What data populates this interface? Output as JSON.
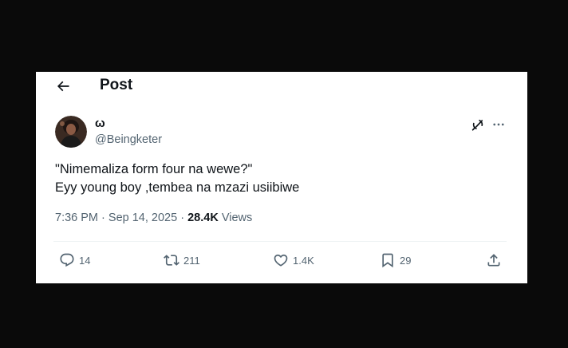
{
  "header": {
    "title": "Post",
    "back_icon": "arrow-left-icon"
  },
  "author": {
    "name": "ω",
    "handle": "@Beingketer"
  },
  "post": {
    "lines": [
      "\"Nimemaliza form four na wewe?\"",
      "Eyy young boy ,tembea na mzazi usiibiwe"
    ]
  },
  "meta": {
    "time": "7:36 PM",
    "sep1": "·",
    "date": "Sep 14, 2025",
    "sep2": "·",
    "views_count": "28.4K",
    "views_label": "Views"
  },
  "actions": {
    "reply": {
      "icon": "reply-icon",
      "count": "14"
    },
    "repost": {
      "icon": "repost-icon",
      "count": "211"
    },
    "like": {
      "icon": "heart-icon",
      "count": "1.4K"
    },
    "bookmark": {
      "icon": "bookmark-icon",
      "count": "29"
    },
    "share": {
      "icon": "share-icon"
    }
  },
  "colors": {
    "text_primary": "#0f1419",
    "text_secondary": "#536471",
    "background_outer": "#0a0a0a",
    "card": "#ffffff",
    "divider": "#eff3f4"
  }
}
